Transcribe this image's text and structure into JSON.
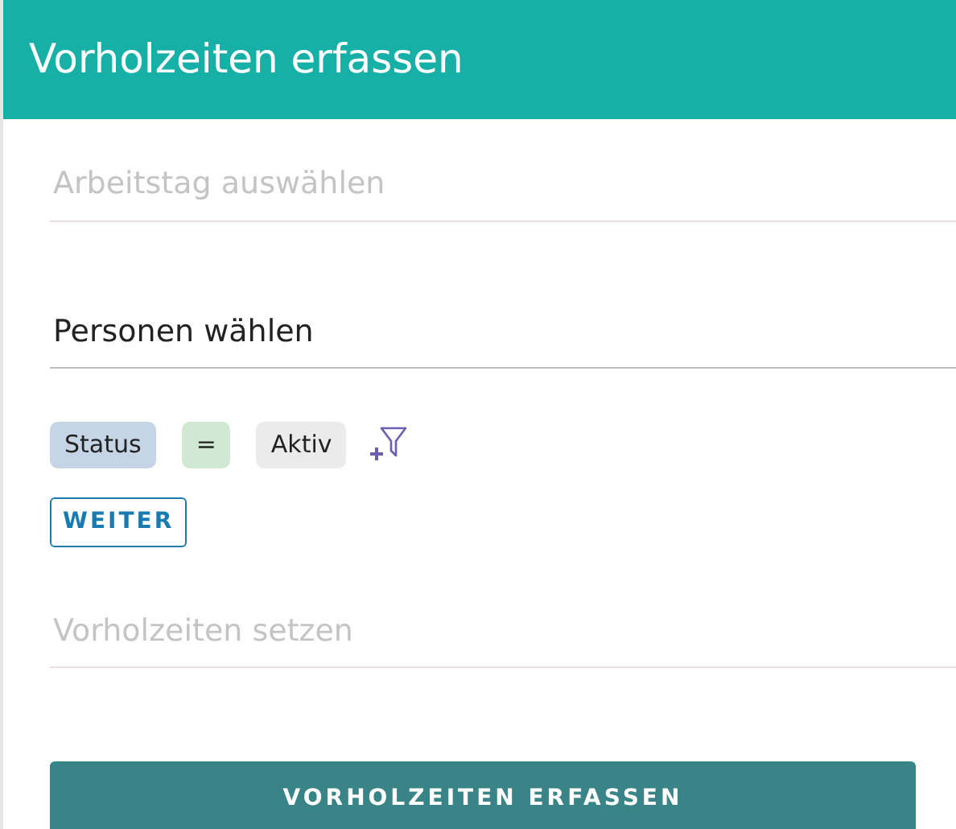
{
  "header": {
    "title": "Vorholzeiten erfassen"
  },
  "workday_field": {
    "placeholder": "Arbeitstag auswählen"
  },
  "persons_field": {
    "value": "Personen wählen"
  },
  "filter_chips": [
    {
      "label": "Status",
      "color": "#c5d5e6"
    },
    {
      "label": "=",
      "color": "#d1e9d2"
    },
    {
      "label": "Aktiv",
      "color": "#ebebeb"
    }
  ],
  "next_button": {
    "label": "WEITER"
  },
  "times_field": {
    "placeholder": "Vorholzeiten setzen"
  },
  "submit_button": {
    "label": "VORHOLZEITEN ERFASSEN"
  }
}
